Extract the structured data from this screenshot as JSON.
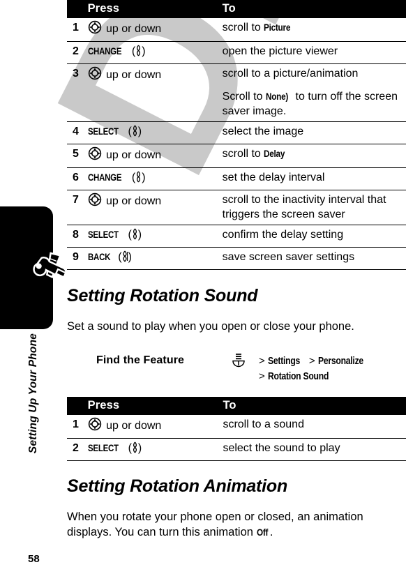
{
  "page": {
    "number": "58",
    "chapter_tab_label": "Setting Up Your Phone",
    "chapter_tab_icon": "wrench-screwdriver-icon",
    "watermark": "DRAFT",
    "watermark_color": "#c9c9c9"
  },
  "icons": {
    "nav_key": "navigation-key-icon",
    "soft_key_right": "right-soft-key-icon",
    "soft_key_left": "left-soft-key-icon",
    "menu_key": "menu-key-icon"
  },
  "table_screensaver": {
    "headers": {
      "num": "",
      "press": "Press",
      "to": "To"
    },
    "rows": [
      {
        "num": "1",
        "press_icon": "navigation-key-icon",
        "press_softkey": "",
        "press_text": "up or down",
        "to_lines": [
          {
            "pre": "scroll to ",
            "term": "Picture",
            "post": ""
          }
        ]
      },
      {
        "num": "2",
        "press_icon": "right-soft-key-icon",
        "press_softkey": "CHANGE",
        "press_text": "",
        "to_lines": [
          {
            "pre": "open the picture viewer",
            "term": "",
            "post": ""
          }
        ]
      },
      {
        "num": "3",
        "press_icon": "navigation-key-icon",
        "press_softkey": "",
        "press_text": "up or down",
        "to_lines": [
          {
            "pre": "scroll to a picture/animation",
            "term": "",
            "post": ""
          },
          {
            "pre": "Scroll to ",
            "term": "None)",
            "post": " to turn off the screen saver image."
          }
        ]
      },
      {
        "num": "4",
        "press_icon": "right-soft-key-icon",
        "press_softkey": "SELECT",
        "press_text": "",
        "to_lines": [
          {
            "pre": "select the image",
            "term": "",
            "post": ""
          }
        ]
      },
      {
        "num": "5",
        "press_icon": "navigation-key-icon",
        "press_softkey": "",
        "press_text": "up or down",
        "to_lines": [
          {
            "pre": "scroll to ",
            "term": "Delay",
            "post": ""
          }
        ]
      },
      {
        "num": "6",
        "press_icon": "right-soft-key-icon",
        "press_softkey": "CHANGE",
        "press_text": "",
        "to_lines": [
          {
            "pre": "set the delay interval",
            "term": "",
            "post": ""
          }
        ]
      },
      {
        "num": "7",
        "press_icon": "navigation-key-icon",
        "press_softkey": "",
        "press_text": "up or down",
        "to_lines": [
          {
            "pre": "scroll to the inactivity interval that triggers the screen saver",
            "term": "",
            "post": ""
          }
        ]
      },
      {
        "num": "8",
        "press_icon": "right-soft-key-icon",
        "press_softkey": "SELECT",
        "press_text": "",
        "to_lines": [
          {
            "pre": "confirm the delay setting",
            "term": "",
            "post": ""
          }
        ]
      },
      {
        "num": "9",
        "press_icon": "left-soft-key-icon",
        "press_softkey": "BACK",
        "press_text": "",
        "to_lines": [
          {
            "pre": "save screen saver settings",
            "term": "",
            "post": ""
          }
        ]
      }
    ]
  },
  "section_rotation_sound": {
    "heading": "Setting Rotation Sound",
    "intro": "Set a sound to play when you open or close your phone.",
    "find_the_feature": {
      "label": "Find the Feature",
      "icon": "menu-key-icon",
      "line1_sep1": ">",
      "line1_item1": "Settings",
      "line1_sep2": ">",
      "line1_item2": "Personalize",
      "line2_sep1": ">",
      "line2_item1": "Rotation Sound"
    },
    "table": {
      "headers": {
        "num": "",
        "press": "Press",
        "to": "To"
      },
      "rows": [
        {
          "num": "1",
          "press_icon": "navigation-key-icon",
          "press_softkey": "",
          "press_text": "up or down",
          "to_lines": [
            {
              "pre": "scroll to a sound",
              "term": "",
              "post": ""
            }
          ]
        },
        {
          "num": "2",
          "press_icon": "right-soft-key-icon",
          "press_softkey": "SELECT",
          "press_text": "",
          "to_lines": [
            {
              "pre": "select the sound to play",
              "term": "",
              "post": ""
            }
          ]
        }
      ]
    }
  },
  "section_rotation_animation": {
    "heading": "Setting Rotation Animation",
    "body_pre": "When you rotate your phone open or closed, an animation displays. You can turn this animation ",
    "body_term": "Off",
    "body_post": "."
  }
}
